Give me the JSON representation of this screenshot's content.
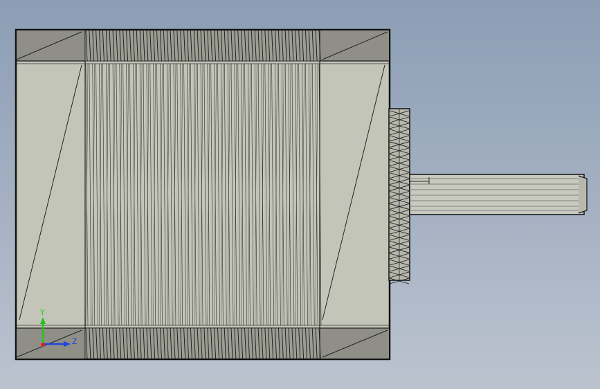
{
  "viewport": {
    "background_top": "#8c9db4",
    "background_bottom": "#bcc3cf"
  },
  "model": {
    "body_fill": "#c4c5b9",
    "end_cap_fill": "#8f8f87",
    "fin_count": 70,
    "knurl_count": 28,
    "edge_color": "#111111"
  },
  "triad": {
    "y_label": "Y",
    "z_label": "Z",
    "y_color": "#22c422",
    "z_color": "#2244dd",
    "x_color": "#dd2222"
  }
}
